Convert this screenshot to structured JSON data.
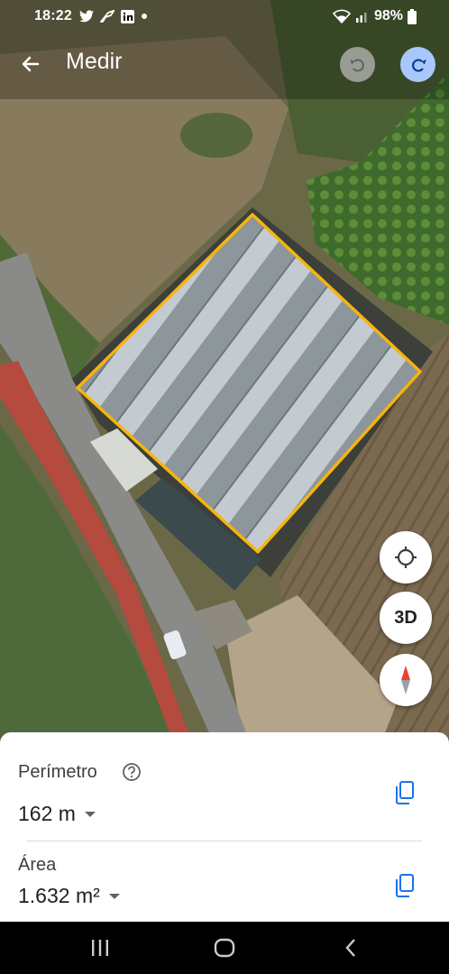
{
  "status_bar": {
    "time": "18:22",
    "battery": "98%",
    "icons": [
      "twitter-icon",
      "feather-icon",
      "linkedin-icon",
      "dot-icon",
      "wifi-icon",
      "signal-icon",
      "battery-icon"
    ]
  },
  "app_bar": {
    "title": "Medir",
    "icons": [
      "back-arrow-icon",
      "undo-icon",
      "redo-icon"
    ]
  },
  "map_controls": {
    "view_3d_label": "3D",
    "icons": [
      "my-location-icon",
      "compass-icon"
    ]
  },
  "measurement": {
    "perimeter_label": "Perímetro",
    "perimeter_value": "162 m",
    "area_label": "Área",
    "area_value": "1.632 m²"
  },
  "colors": {
    "polygon_outline": "#f6b40e",
    "accent_blue": "#1a73e8",
    "redo_button": "#a8c7fa",
    "compass_red": "#ea4335"
  }
}
